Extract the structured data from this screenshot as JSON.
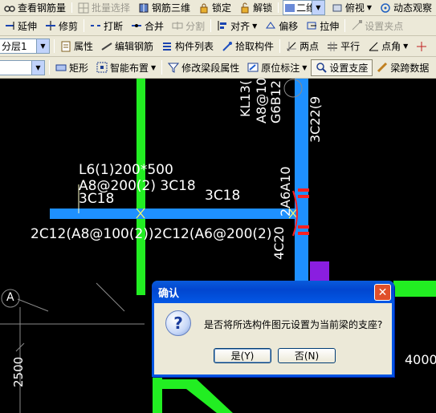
{
  "toolbar1": {
    "view_rebar": "查看钢筋量",
    "batch_select": "批量选择",
    "rebar_3d": "钢筋三维",
    "lock": "锁定",
    "unlock": "解锁",
    "view_mode": "二维",
    "view_angle": "俯视",
    "dynamic_observe": "动态观察"
  },
  "toolbar2": {
    "extend": "延伸",
    "trim": "修剪",
    "break": "打断",
    "merge": "合并",
    "split": "分割",
    "align": "对齐",
    "offset": "偏移",
    "stretch": "拉伸",
    "set_grip": "设置夹点"
  },
  "toolbar3": {
    "layer_select": "分层1",
    "properties": "属性",
    "edit_rebar": "编辑钢筋",
    "component_list": "构件列表",
    "pick_component": "拾取构件",
    "two_points": "两点",
    "parallel": "平行",
    "point_angle": "点角"
  },
  "toolbar4": {
    "rectangle": "矩形",
    "smart_layout": "智能布置",
    "modify_beam_segment": "修改梁段属性",
    "in_situ_annotation": "原位标注",
    "set_support": "设置支座",
    "cross_span_data": "梁跨数据"
  },
  "canvas": {
    "beam_label_1": "L6(1)200*500",
    "beam_label_2": "A8@200(2) 3C18",
    "beam_label_3": "3C18",
    "beam_label_4": "3C18",
    "beam_label_5": "2C12(A8@100(2))2C12(A6@200(2)",
    "kl_label_1": "KL13(",
    "kl_label_2": "A8@10",
    "kl_label_3": "G6B12",
    "kl_label_4": "3C22(9",
    "vert_label_1": "2A6A10",
    "vert_label_2": "4C20",
    "axis_label": "A",
    "dim_left": "2500",
    "dim_right": "4000",
    "colors": {
      "beam_blue": "#1e90ff",
      "beam_green": "#22ee22",
      "support_red": "#ff2020",
      "purple_block": "#8a1ee0"
    }
  },
  "dialog": {
    "title": "确认",
    "message": "是否将所选构件图元设置为当前梁的支座?",
    "yes_label": "是(Y)",
    "no_label": "否(N)",
    "close_glyph": "✕",
    "icon": "question-icon"
  }
}
